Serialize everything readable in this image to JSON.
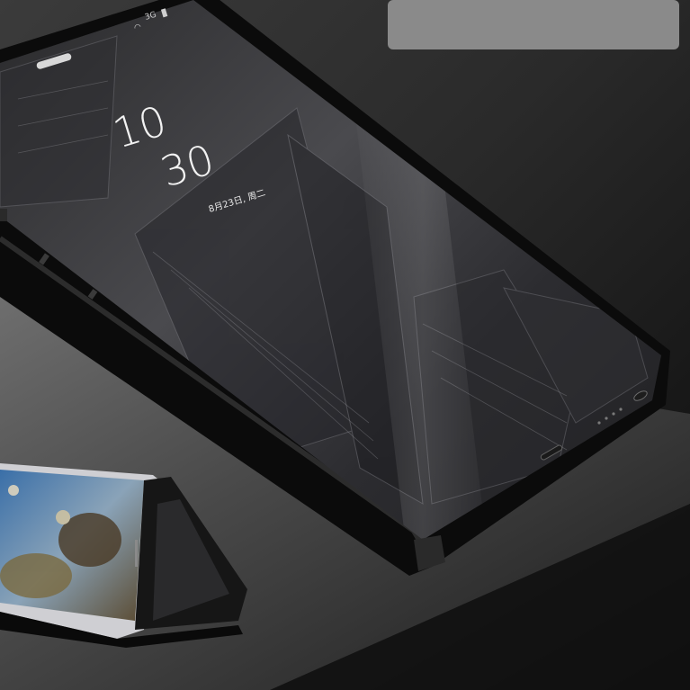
{
  "status_bar": {
    "network": "3G"
  },
  "lock_screen": {
    "hour": "10",
    "minute": "30",
    "date": "8月23日, 周二"
  },
  "colors": {
    "case_black": "#0b0b0b",
    "mirror_gray": "#3a3a3c",
    "table_surface": "#5a5a5a",
    "overlay_box": "#8a8a8a"
  }
}
